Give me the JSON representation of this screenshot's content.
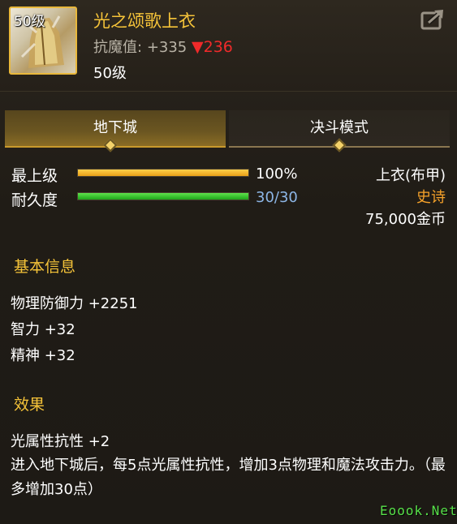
{
  "item": {
    "level_badge": "50级",
    "name": "光之颂歌上衣",
    "resist_label": "抗魔值:",
    "resist_value": "+335",
    "resist_change": "▼236",
    "level_required": "50级"
  },
  "tabs": [
    {
      "label": "地下城",
      "active": true
    },
    {
      "label": "决斗模式",
      "active": false
    }
  ],
  "bars": [
    {
      "label": "最上级",
      "value_text": "100%",
      "fraction": 1.0
    },
    {
      "label": "耐久度",
      "value_text": "30/30",
      "fraction": 1.0
    }
  ],
  "info": {
    "type": "上衣(布甲)",
    "rarity": "史诗",
    "price": "75,000金币"
  },
  "basic": {
    "title": "基本信息",
    "stats": [
      "物理防御力 +2251",
      "智力 +32",
      "精神 +32"
    ]
  },
  "effects": {
    "title": "效果",
    "lines": [
      "光属性抗性 +2",
      "进入地下城后，每5点光属性抗性，增加3点物理和魔法攻击力。（最多增加30点）"
    ]
  },
  "watermark": "Eoook.Net",
  "colors": {
    "gold": "#f5c339",
    "epic": "#f6a22a",
    "down": "#f02a2a",
    "durability": "#8db6e6"
  }
}
